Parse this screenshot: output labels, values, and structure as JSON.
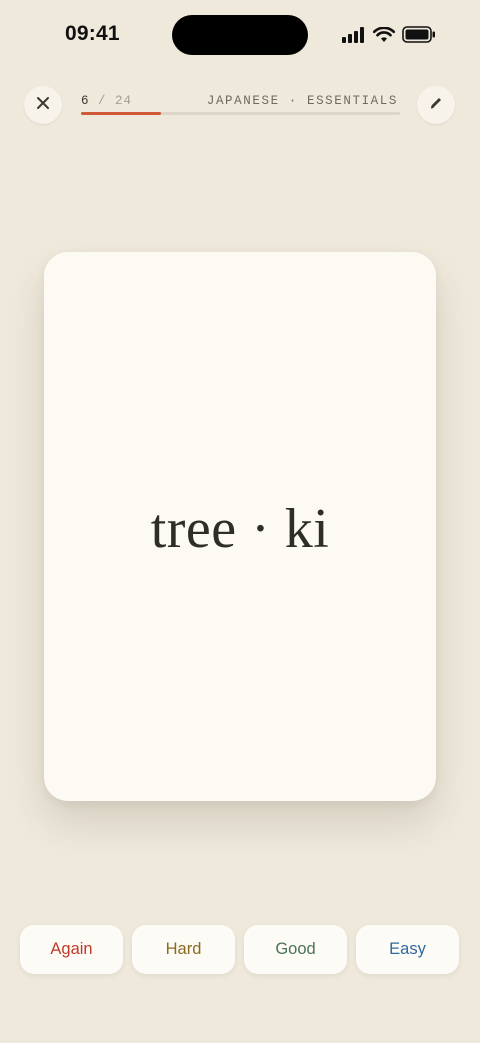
{
  "status_bar": {
    "time": "09:41",
    "icons": [
      "cellular-signal-icon",
      "wifi-icon",
      "battery-icon"
    ]
  },
  "top_bar": {
    "close_icon": "close-icon",
    "edit_icon": "pencil-icon",
    "progress": {
      "current": "6",
      "separator_total": " / 24",
      "fraction": 0.25
    },
    "deck_title": "JAPANESE · ESSENTIALS"
  },
  "card": {
    "text": "tree · ki"
  },
  "ratings": [
    {
      "label": "Again",
      "color": "#c0392b"
    },
    {
      "label": "Hard",
      "color": "#8a6a1f"
    },
    {
      "label": "Good",
      "color": "#4a7256"
    },
    {
      "label": "Easy",
      "color": "#2f6aa0"
    }
  ],
  "colors": {
    "background": "#efe9dc",
    "card": "#fcfaf3",
    "accent": "#cf5a35"
  }
}
